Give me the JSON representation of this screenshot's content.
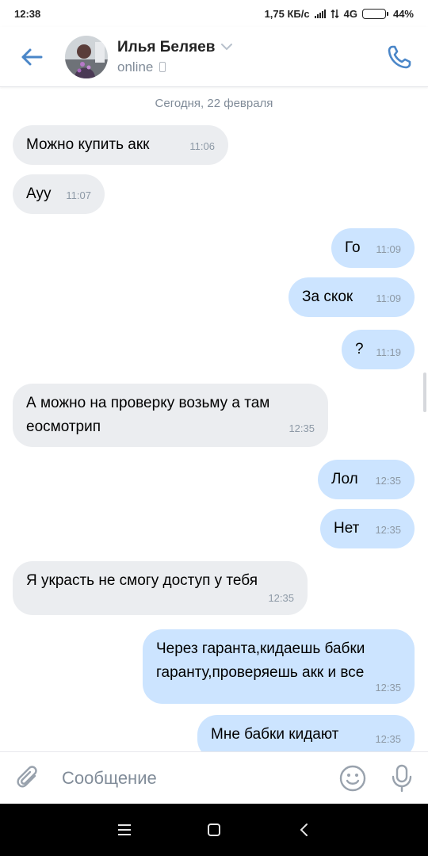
{
  "status_bar": {
    "time": "12:38",
    "net_speed": "1,75 КБ/с",
    "network_type": "4G",
    "battery": "44%",
    "battery_level": 0.44
  },
  "header": {
    "contact_name": "Илья Беляев",
    "presence": "online",
    "icons": {
      "back": "arrow-left-icon",
      "dropdown": "chevron-down-icon",
      "device": "mobile-device-icon",
      "call": "phone-icon"
    }
  },
  "feed": {
    "date_label": "Сегодня, 22 февраля",
    "messages": [
      {
        "dir": "in",
        "lines": [
          "Можно купить акк"
        ],
        "time": "11:06"
      },
      {
        "dir": "in",
        "lines": [
          "Ауу"
        ],
        "time": "11:07"
      },
      {
        "dir": "out",
        "lines": [
          "Го"
        ],
        "time": "11:09"
      },
      {
        "dir": "out",
        "lines": [
          "За скок"
        ],
        "time": "11:09"
      },
      {
        "dir": "out",
        "lines": [
          "?"
        ],
        "time": "11:19"
      },
      {
        "dir": "in",
        "lines": [
          "А можно на проверку возьму а там",
          "еосмотрип"
        ],
        "time": "12:35"
      },
      {
        "dir": "out",
        "lines": [
          "Лол"
        ],
        "time": "12:35"
      },
      {
        "dir": "out",
        "lines": [
          "Нет"
        ],
        "time": "12:35"
      },
      {
        "dir": "in",
        "lines": [
          "Я украсть не смогу доступ у тебя"
        ],
        "time": "12:35"
      },
      {
        "dir": "out",
        "lines": [
          "Через гаранта,кидаешь бабки",
          "гаранту,проверяешь акк и все"
        ],
        "time": "12:35"
      },
      {
        "dir": "out",
        "lines": [
          "Мне бабки кидают"
        ],
        "time": "12:35"
      }
    ]
  },
  "composer": {
    "placeholder": "Сообщение",
    "value": "",
    "icons": {
      "attach": "paperclip-icon",
      "emoji": "smiley-icon",
      "voice": "microphone-icon"
    }
  },
  "nav": {
    "icons": [
      "menu-icon",
      "home-square-icon",
      "back-chevron-icon"
    ]
  },
  "colors": {
    "accent": "#4a86c8",
    "incoming_bubble": "#ebedf0",
    "outgoing_bubble": "#cce4ff",
    "secondary_text": "#818c99"
  }
}
